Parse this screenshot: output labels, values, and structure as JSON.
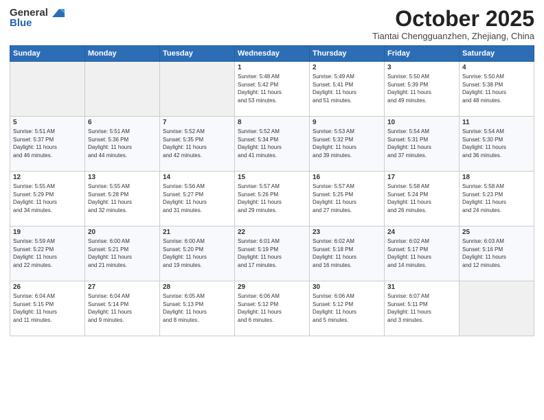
{
  "logo": {
    "general": "General",
    "blue": "Blue"
  },
  "title": "October 2025",
  "location": "Tiantai Chengguanzhen, Zhejiang, China",
  "headers": [
    "Sunday",
    "Monday",
    "Tuesday",
    "Wednesday",
    "Thursday",
    "Friday",
    "Saturday"
  ],
  "weeks": [
    [
      {
        "day": "",
        "info": ""
      },
      {
        "day": "",
        "info": ""
      },
      {
        "day": "",
        "info": ""
      },
      {
        "day": "1",
        "info": "Sunrise: 5:48 AM\nSunset: 5:42 PM\nDaylight: 11 hours\nand 53 minutes."
      },
      {
        "day": "2",
        "info": "Sunrise: 5:49 AM\nSunset: 5:41 PM\nDaylight: 11 hours\nand 51 minutes."
      },
      {
        "day": "3",
        "info": "Sunrise: 5:50 AM\nSunset: 5:39 PM\nDaylight: 11 hours\nand 49 minutes."
      },
      {
        "day": "4",
        "info": "Sunrise: 5:50 AM\nSunset: 5:38 PM\nDaylight: 11 hours\nand 48 minutes."
      }
    ],
    [
      {
        "day": "5",
        "info": "Sunrise: 5:51 AM\nSunset: 5:37 PM\nDaylight: 11 hours\nand 46 minutes."
      },
      {
        "day": "6",
        "info": "Sunrise: 5:51 AM\nSunset: 5:36 PM\nDaylight: 11 hours\nand 44 minutes."
      },
      {
        "day": "7",
        "info": "Sunrise: 5:52 AM\nSunset: 5:35 PM\nDaylight: 11 hours\nand 42 minutes."
      },
      {
        "day": "8",
        "info": "Sunrise: 5:52 AM\nSunset: 5:34 PM\nDaylight: 11 hours\nand 41 minutes."
      },
      {
        "day": "9",
        "info": "Sunrise: 5:53 AM\nSunset: 5:32 PM\nDaylight: 11 hours\nand 39 minutes."
      },
      {
        "day": "10",
        "info": "Sunrise: 5:54 AM\nSunset: 5:31 PM\nDaylight: 11 hours\nand 37 minutes."
      },
      {
        "day": "11",
        "info": "Sunrise: 5:54 AM\nSunset: 5:30 PM\nDaylight: 11 hours\nand 36 minutes."
      }
    ],
    [
      {
        "day": "12",
        "info": "Sunrise: 5:55 AM\nSunset: 5:29 PM\nDaylight: 11 hours\nand 34 minutes."
      },
      {
        "day": "13",
        "info": "Sunrise: 5:55 AM\nSunset: 5:28 PM\nDaylight: 11 hours\nand 32 minutes."
      },
      {
        "day": "14",
        "info": "Sunrise: 5:56 AM\nSunset: 5:27 PM\nDaylight: 11 hours\nand 31 minutes."
      },
      {
        "day": "15",
        "info": "Sunrise: 5:57 AM\nSunset: 5:26 PM\nDaylight: 11 hours\nand 29 minutes."
      },
      {
        "day": "16",
        "info": "Sunrise: 5:57 AM\nSunset: 5:25 PM\nDaylight: 11 hours\nand 27 minutes."
      },
      {
        "day": "17",
        "info": "Sunrise: 5:58 AM\nSunset: 5:24 PM\nDaylight: 11 hours\nand 26 minutes."
      },
      {
        "day": "18",
        "info": "Sunrise: 5:58 AM\nSunset: 5:23 PM\nDaylight: 11 hours\nand 24 minutes."
      }
    ],
    [
      {
        "day": "19",
        "info": "Sunrise: 5:59 AM\nSunset: 5:22 PM\nDaylight: 11 hours\nand 22 minutes."
      },
      {
        "day": "20",
        "info": "Sunrise: 6:00 AM\nSunset: 5:21 PM\nDaylight: 11 hours\nand 21 minutes."
      },
      {
        "day": "21",
        "info": "Sunrise: 6:00 AM\nSunset: 5:20 PM\nDaylight: 11 hours\nand 19 minutes."
      },
      {
        "day": "22",
        "info": "Sunrise: 6:01 AM\nSunset: 5:19 PM\nDaylight: 11 hours\nand 17 minutes."
      },
      {
        "day": "23",
        "info": "Sunrise: 6:02 AM\nSunset: 5:18 PM\nDaylight: 11 hours\nand 16 minutes."
      },
      {
        "day": "24",
        "info": "Sunrise: 6:02 AM\nSunset: 5:17 PM\nDaylight: 11 hours\nand 14 minutes."
      },
      {
        "day": "25",
        "info": "Sunrise: 6:03 AM\nSunset: 5:16 PM\nDaylight: 11 hours\nand 12 minutes."
      }
    ],
    [
      {
        "day": "26",
        "info": "Sunrise: 6:04 AM\nSunset: 5:15 PM\nDaylight: 11 hours\nand 11 minutes."
      },
      {
        "day": "27",
        "info": "Sunrise: 6:04 AM\nSunset: 5:14 PM\nDaylight: 11 hours\nand 9 minutes."
      },
      {
        "day": "28",
        "info": "Sunrise: 6:05 AM\nSunset: 5:13 PM\nDaylight: 11 hours\nand 8 minutes."
      },
      {
        "day": "29",
        "info": "Sunrise: 6:06 AM\nSunset: 5:12 PM\nDaylight: 11 hours\nand 6 minutes."
      },
      {
        "day": "30",
        "info": "Sunrise: 6:06 AM\nSunset: 5:12 PM\nDaylight: 11 hours\nand 5 minutes."
      },
      {
        "day": "31",
        "info": "Sunrise: 6:07 AM\nSunset: 5:11 PM\nDaylight: 11 hours\nand 3 minutes."
      },
      {
        "day": "",
        "info": ""
      }
    ]
  ]
}
